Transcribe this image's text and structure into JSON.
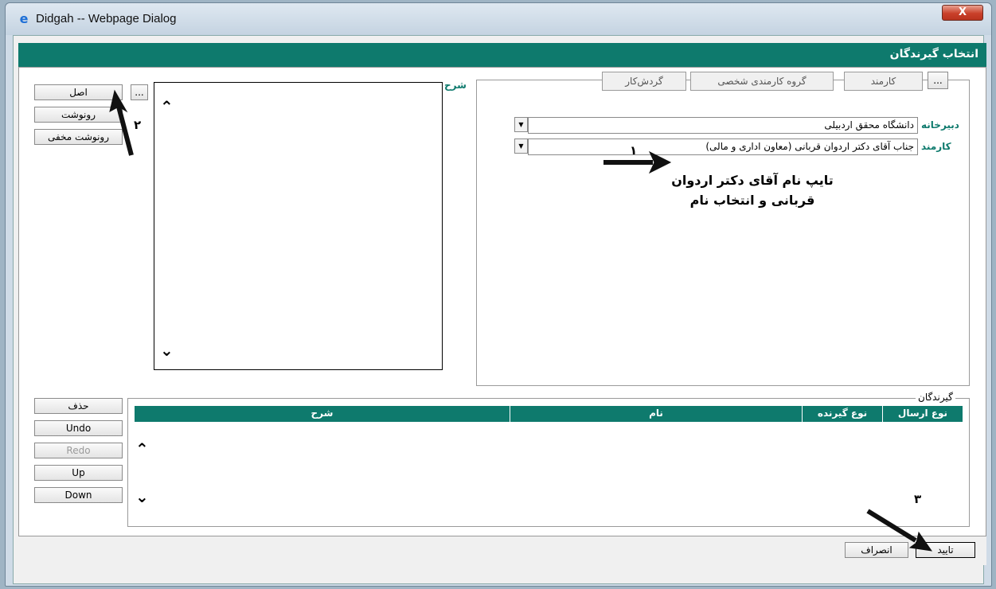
{
  "window": {
    "title": "Didgah -- Webpage Dialog",
    "close_label": "X",
    "app_icon": "ie-icon"
  },
  "header": {
    "title": "انتخاب گیرندگان"
  },
  "left_buttons": {
    "more": "...",
    "asl": "اصل",
    "ronevesht": "رونوشت",
    "ronevesht_makhfi": "رونوشت مخفی"
  },
  "description": {
    "label": "شرح"
  },
  "tabs": {
    "more": "...",
    "items": [
      "کارمند",
      "گروه کارمندی شخصی",
      "گردش‌کار"
    ]
  },
  "fields": {
    "dabirkhaneh_label": "دبیرخانه",
    "dabirkhaneh_value": "دانشگاه محقق اردبیلی",
    "karmand_label": "کارمند",
    "karmand_value": "جناب آقای دکتر اردوان قربانی (معاون اداری و مالی)"
  },
  "recipients": {
    "legend": "گیرندگان",
    "columns": [
      "نوع ارسال",
      "نوع گیرنده",
      "نام",
      "شرح"
    ],
    "rows": []
  },
  "action_buttons": {
    "delete": "حذف",
    "undo": "Undo",
    "redo": "Redo",
    "up": "Up",
    "down": "Down"
  },
  "footer": {
    "confirm": "تایید",
    "cancel": "انصراف"
  },
  "annotations": {
    "step1": "۱",
    "step2": "۲",
    "step3": "۳",
    "instruction_line1": "تایپ نام آقای دکتر اردوان",
    "instruction_line2": "قربانی و انتخاب نام"
  },
  "colors": {
    "accent": "#0e7a6d",
    "header_text": "#ffffff"
  }
}
